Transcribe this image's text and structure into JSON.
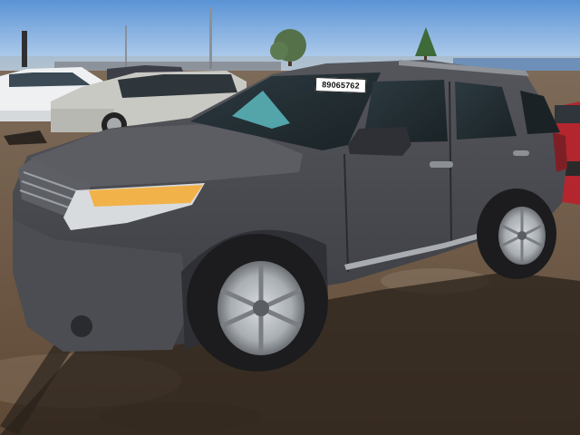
{
  "photo": {
    "lot_sticker_text": "89065762",
    "colors": {
      "sky_top": "#5a93d6",
      "sky_bottom": "#b9d3ee",
      "ground": "#6e5843",
      "suv_body": "#4a4b50",
      "shadow": "#2a221b",
      "white_car": "#eef0f2",
      "silver_car": "#c9c9c4",
      "red_car": "#b3262e",
      "building": "#6d8fb8"
    }
  }
}
